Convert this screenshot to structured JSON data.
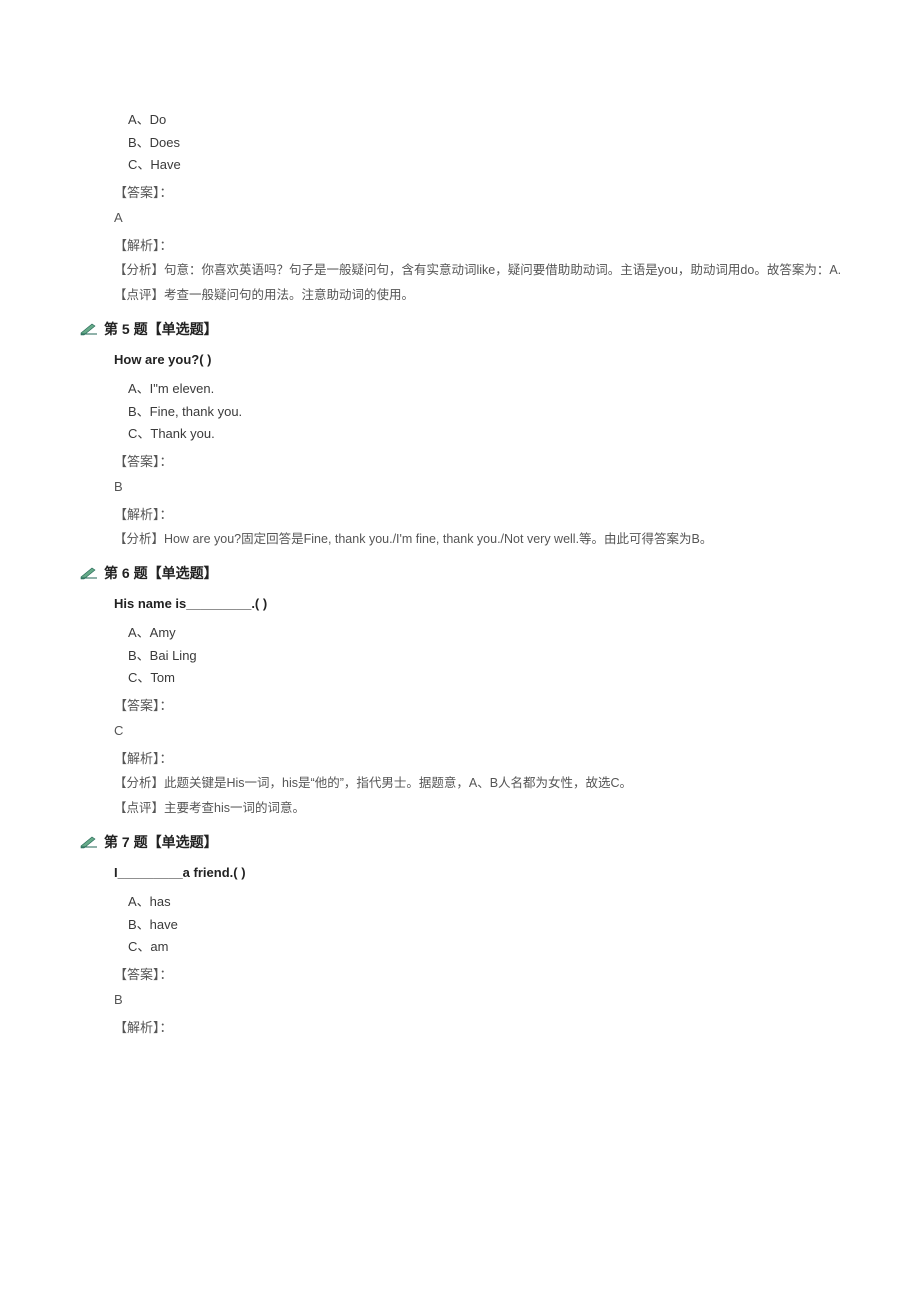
{
  "q4": {
    "options": {
      "a": "A、Do",
      "b": "B、Does",
      "c": "C、Have"
    },
    "answer_label": "【答案】：",
    "answer": "A",
    "analysis_label": "【解析】：",
    "analysis_p1": "【分析】句意：你喜欢英语吗？句子是一般疑问句，含有实意动词like，疑问要借助助动词。主语是you，助动词用do。故答案为：A.",
    "analysis_p2": "【点评】考查一般疑问句的用法。注意助动词的使用。"
  },
  "q5": {
    "header": "第 5 题【单选题】",
    "stem": "How are you?(       )",
    "options": {
      "a": "A、I\"m eleven.",
      "b": "B、Fine, thank you.",
      "c": "C、Thank you."
    },
    "answer_label": "【答案】：",
    "answer": "B",
    "analysis_label": "【解析】：",
    "analysis_p1": "【分析】How are you?固定回答是Fine, thank you./I'm fine, thank you./Not very well.等。由此可得答案为B。"
  },
  "q6": {
    "header": "第 6 题【单选题】",
    "stem": "His name is_________.(       )",
    "options": {
      "a": "A、Amy",
      "b": "B、Bai Ling",
      "c": "C、Tom"
    },
    "answer_label": "【答案】：",
    "answer": "C",
    "analysis_label": "【解析】：",
    "analysis_p1": "【分析】此题关键是His一词，his是“他的”，指代男士。据题意，A、B人名都为女性，故选C。",
    "analysis_p2": "【点评】主要考查his一词的词意。"
  },
  "q7": {
    "header": "第 7 题【单选题】",
    "stem": "I_________a friend.(       )",
    "options": {
      "a": "A、has",
      "b": "B、have",
      "c": "C、am"
    },
    "answer_label": "【答案】：",
    "answer": "B",
    "analysis_label": "【解析】："
  }
}
